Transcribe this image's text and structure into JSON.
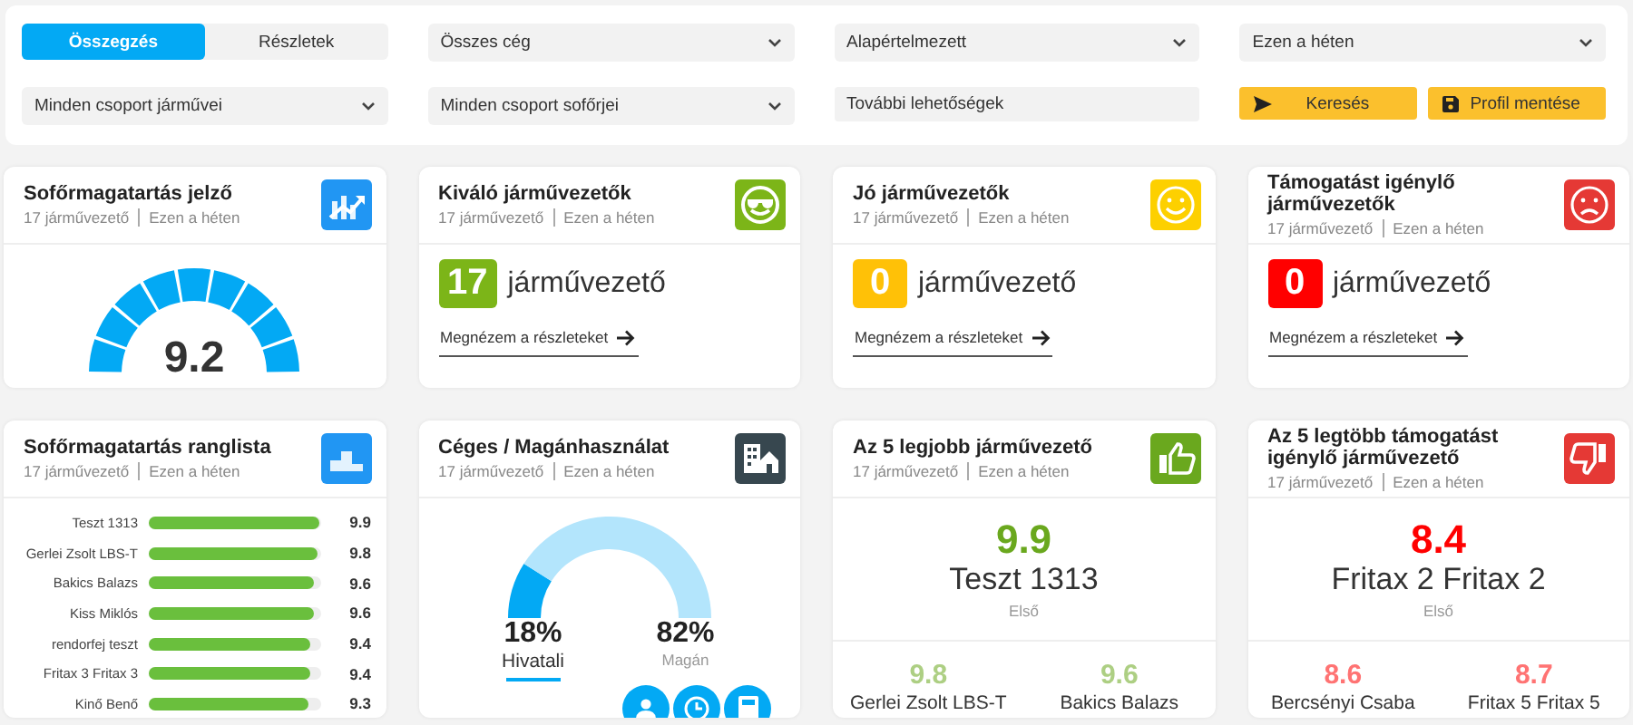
{
  "filters": {
    "tabs": [
      {
        "label": "Összegzés",
        "selected": true
      },
      {
        "label": "Részletek",
        "selected": false
      }
    ],
    "dropdowns": [
      {
        "value": "Összes cég"
      },
      {
        "value": "Alapértelmezett"
      },
      {
        "value": "Ezen a héten"
      },
      {
        "value": "Minden csoport járművei"
      },
      {
        "value": "Minden csoport sofőrjei"
      }
    ],
    "more_options": {
      "value": "További lehetőségek"
    },
    "buttons": [
      {
        "kind": "search",
        "label": "Keresés"
      },
      {
        "kind": "save",
        "label": "Profil mentése"
      }
    ]
  },
  "cards": [
    {
      "kind": "gauge",
      "title": "Sofőrmagatartás jelző",
      "drivers": "17 járművezető",
      "period": "Ezen a héten",
      "score": "9.2"
    },
    {
      "kind": "count",
      "title": "Kiváló járművezetők",
      "drivers": "17 járművezető",
      "period": "Ezen a héten",
      "count": "17",
      "unit": "járművezető",
      "color": "#7cb518",
      "link": "Megnézem a részleteket"
    },
    {
      "kind": "count",
      "title": "Jó járművezetők",
      "drivers": "17 járművezető",
      "period": "Ezen a héten",
      "count": "0",
      "unit": "járművezető",
      "color": "#ffc107",
      "link": "Megnézem a részleteket"
    },
    {
      "kind": "count",
      "title": "Támogatást igénylő járművezetők",
      "drivers": "17 járművezető",
      "period": "Ezen a héten",
      "count": "0",
      "unit": "járművezető",
      "color": "#ff0000",
      "link": "Megnézem a részleteket"
    },
    {
      "kind": "ranking",
      "title": "Sofőrmagatartás ranglista",
      "drivers": "17 járművezető",
      "period": "Ezen a héten",
      "rows": [
        {
          "name": "Teszt 1313",
          "score": "9.9",
          "level": 0.99
        },
        {
          "name": "Gerlei Zsolt LBS-T",
          "score": "9.8",
          "level": 0.98
        },
        {
          "name": "Bakics Balazs",
          "score": "9.6",
          "level": 0.96
        },
        {
          "name": "Kiss Miklós",
          "score": "9.6",
          "level": 0.96
        },
        {
          "name": "rendorfej teszt",
          "score": "9.4",
          "level": 0.94
        },
        {
          "name": "Fritax 3 Fritax 3",
          "score": "9.4",
          "level": 0.94
        },
        {
          "name": "Kinő Benő",
          "score": "9.3",
          "level": 0.93
        }
      ]
    },
    {
      "kind": "usage",
      "title": "Céges / Magánhasználat",
      "drivers": "17 járművezető",
      "period": "Ezen a héten",
      "segments": [
        {
          "percent": "18%",
          "label": "Hivatali",
          "color": "#03a9f4",
          "selected": true
        },
        {
          "percent": "82%",
          "label": "Magán",
          "color": "#b3e5fc",
          "selected": false
        }
      ]
    },
    {
      "kind": "top",
      "title": "Az 5 legjobb járművezető",
      "drivers": "17 járművezető",
      "period": "Ezen a héten",
      "color": "#6aa81e",
      "first": {
        "score": "9.9",
        "name": "Teszt 1313",
        "rank": "Első"
      },
      "others": [
        {
          "score": "9.8",
          "name": "Gerlei Zsolt LBS-T"
        },
        {
          "score": "9.6",
          "name": "Bakics Balazs"
        }
      ]
    },
    {
      "kind": "top",
      "title": "Az 5 legtöbb támogatást igénylő járművezető",
      "drivers": "17 járművezető",
      "period": "Ezen a héten",
      "color": "#ff0000",
      "first": {
        "score": "8.4",
        "name": "Fritax 2 Fritax 2",
        "rank": "Első"
      },
      "others": [
        {
          "score": "8.6",
          "name": "Bercsényi Csaba"
        },
        {
          "score": "8.7",
          "name": "Fritax 5 Fritax 5"
        }
      ]
    }
  ]
}
